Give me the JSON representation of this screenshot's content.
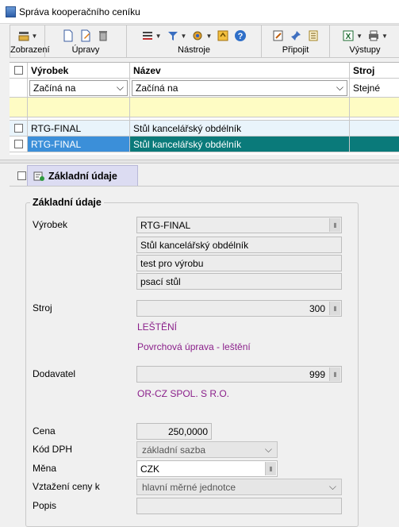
{
  "window": {
    "title": "Správa kooperačního ceníku"
  },
  "toolbar": {
    "groups": [
      {
        "label": "Zobrazení"
      },
      {
        "label": "Úpravy"
      },
      {
        "label": "Nástroje"
      },
      {
        "label": "Připojit"
      },
      {
        "label": "Výstupy"
      }
    ]
  },
  "grid": {
    "columns": [
      "Výrobek",
      "Název",
      "Stroj"
    ],
    "filters": [
      "Začíná na",
      "Začíná na",
      "Stejné"
    ],
    "rows": [
      {
        "vyrobek": "RTG-FINAL",
        "nazev": "Stůl kancelářský obdélník",
        "stroj": ""
      },
      {
        "vyrobek": "RTG-FINAL",
        "nazev": "Stůl kancelářský obdélník",
        "stroj": ""
      }
    ]
  },
  "tab": {
    "label": "Základní údaje"
  },
  "form": {
    "group_title": "Základní údaje",
    "vyrobek": {
      "label": "Výrobek",
      "value": "RTG-FINAL",
      "lines": [
        "Stůl kancelářský obdélník",
        "test pro výrobu",
        "psací stůl"
      ]
    },
    "stroj": {
      "label": "Stroj",
      "value": "300",
      "line1": "LEŠTĚNÍ",
      "line2": "Povrchová úprava - leštění"
    },
    "dodavatel": {
      "label": "Dodavatel",
      "value": "999",
      "name": "OR-CZ SPOL. S R.O."
    },
    "cena": {
      "label": "Cena",
      "value": "250,0000"
    },
    "kod_dph": {
      "label": "Kód DPH",
      "value": "základní sazba"
    },
    "mena": {
      "label": "Měna",
      "value": "CZK"
    },
    "vztazeni": {
      "label": "Vztažení ceny k",
      "value": "hlavní měrné jednotce"
    },
    "popis": {
      "label": "Popis",
      "value": ""
    }
  }
}
